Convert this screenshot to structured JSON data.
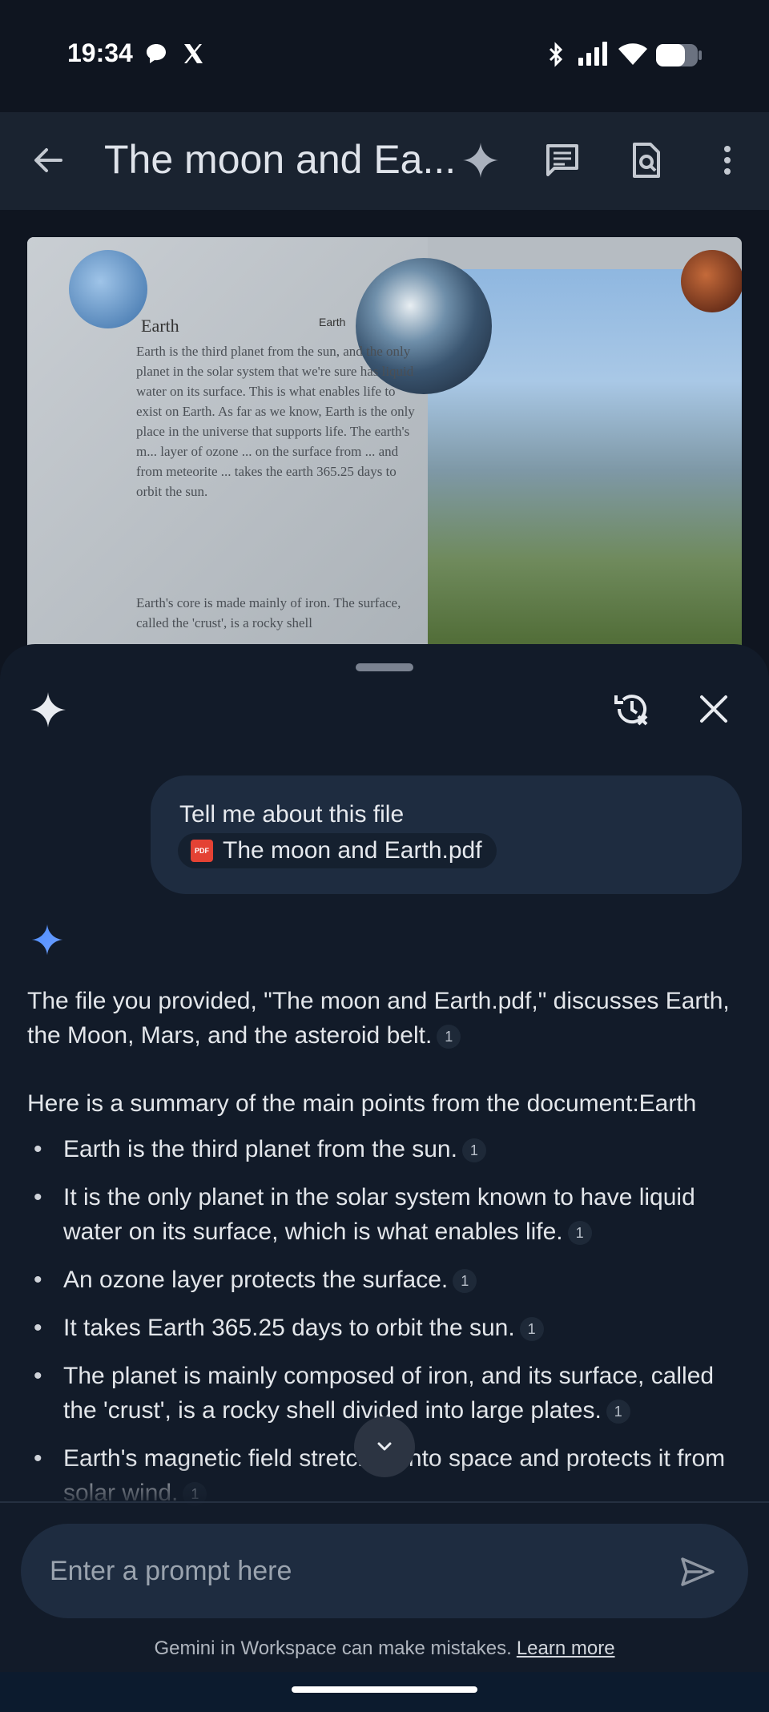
{
  "status_bar": {
    "time": "19:34",
    "left_icons": [
      "chat-bubble-icon",
      "x-logo-icon"
    ],
    "right_icons": [
      "bluetooth-icon",
      "signal-icon",
      "wifi-icon",
      "battery-icon"
    ]
  },
  "app_bar": {
    "title": "The moon and Ea...",
    "icons": [
      "back-arrow-icon",
      "gemini-sparkle-icon",
      "comment-icon",
      "document-search-icon",
      "more-vert-icon"
    ]
  },
  "document_preview": {
    "page_label": "Earth",
    "heading": "Earth",
    "body_text": "Earth is the third planet from the sun, and the only planet in the solar system that we're sure has liquid water on its surface. This is what enables life to exist on Earth. As far as we know, Earth is the only place in the universe that supports life. The earth's m... layer of ozone ... on the surface from ... and from meteorite ... takes the earth 365.25 days to orbit the sun.",
    "body_text_2": "Earth's core is made mainly of iron. The surface, called the 'crust', is a rocky shell"
  },
  "gemini_panel": {
    "icons": [
      "gemini-sparkle-icon",
      "history-clear-icon",
      "close-icon"
    ],
    "user_message": {
      "text": "Tell me about this file",
      "attachment": "The moon and Earth.pdf",
      "attachment_icon_label": "PDF"
    },
    "response": {
      "intro": "The file you provided, \"The moon and Earth.pdf,\" discusses Earth, the Moon, Mars, and the asteroid belt.",
      "intro_cite": "1",
      "summary_heading": "Here is a summary of the main points from the document:Earth",
      "bullets": [
        {
          "text": "Earth is the third planet from the sun.",
          "cite": "1"
        },
        {
          "text": "It is the only planet in the solar system known to have liquid water on its surface, which is what enables life.",
          "cite": "1"
        },
        {
          "text": "An ozone layer protects the surface.",
          "cite": "1"
        },
        {
          "text": "It takes Earth 365.25 days to orbit the sun.",
          "cite": "1"
        },
        {
          "text": "The planet is mainly composed of iron, and its surface, called the 'crust', is a rocky shell divided into large plates.",
          "cite": "1"
        },
        {
          "text": "Earth's magnetic field stretches into space and protects it from solar wind.",
          "cite": "1"
        }
      ]
    },
    "prompt": {
      "placeholder": "Enter a prompt here"
    },
    "disclaimer": "Gemini in Workspace can make mistakes.",
    "learn_more": "Learn more"
  },
  "colors": {
    "background": "#0f1520",
    "app_bar": "#1a2330",
    "sheet": "#121b29",
    "bubble": "#1e2c40",
    "accent_blue": "#4d8dff"
  }
}
